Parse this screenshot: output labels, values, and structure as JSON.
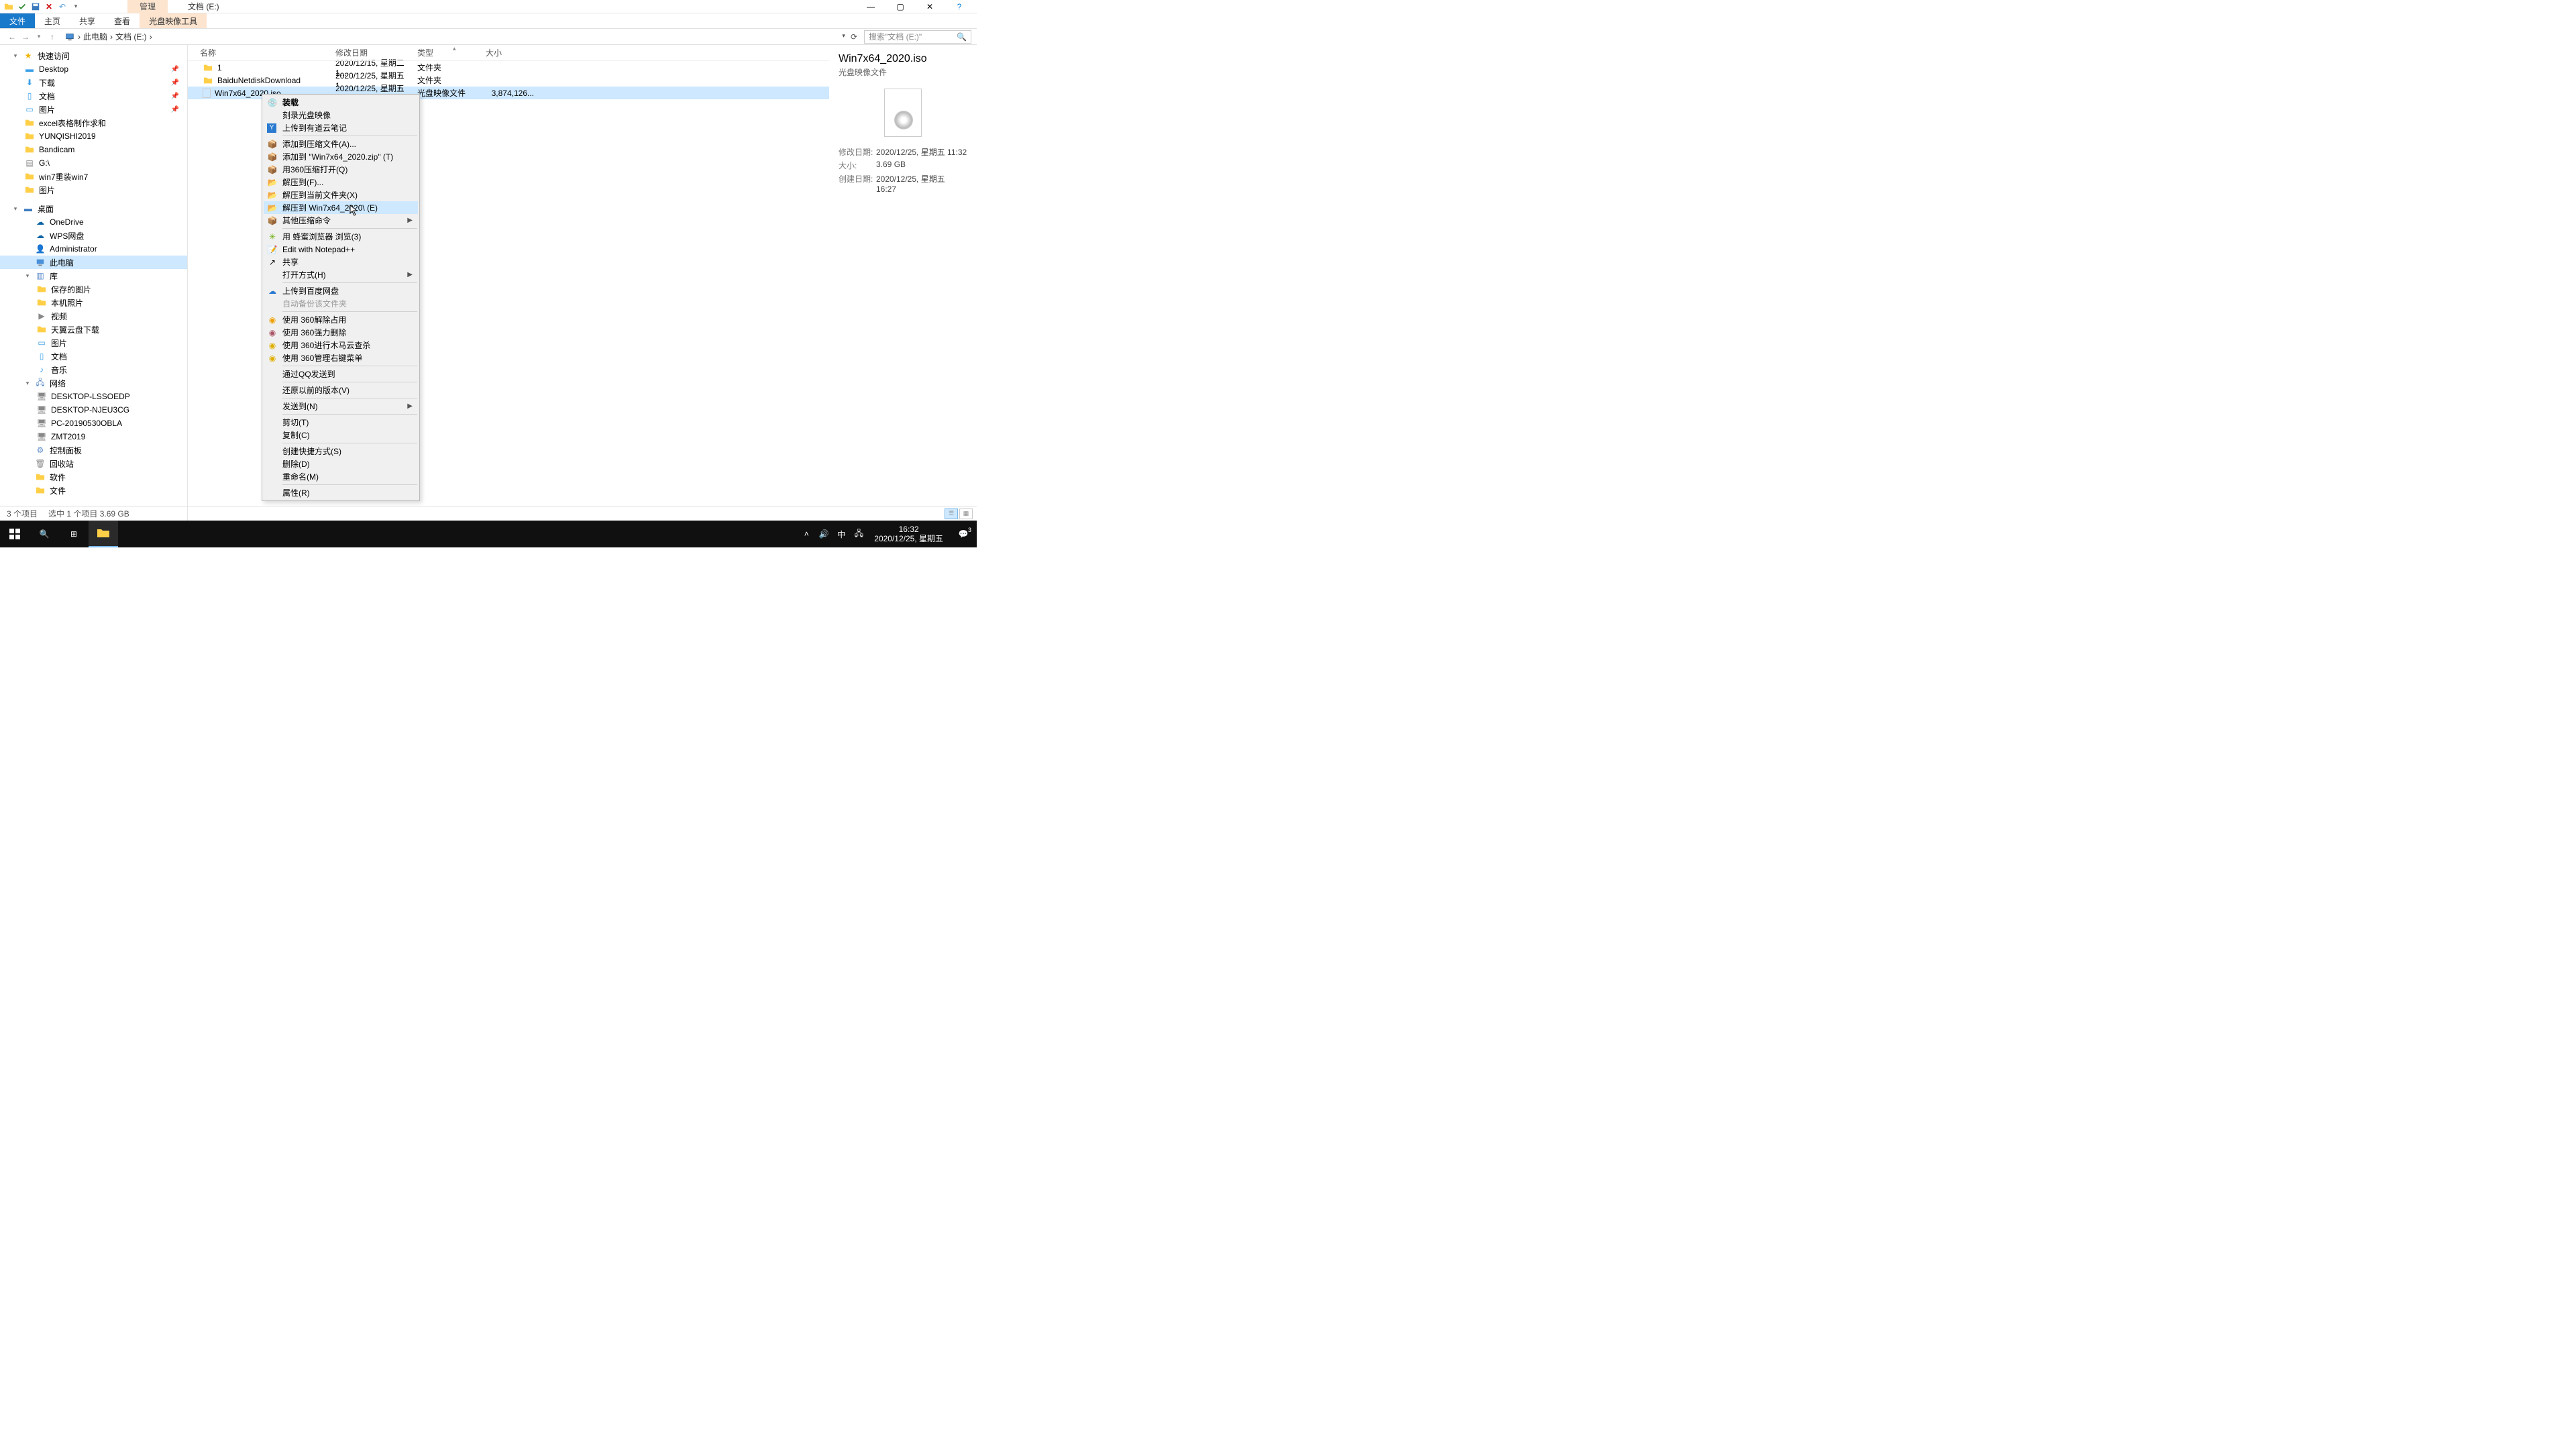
{
  "window": {
    "title": "文档 (E:)"
  },
  "ribbon": {
    "manage_tab": "管理",
    "file_tab": "文件",
    "home": "主页",
    "share": "共享",
    "view": "查看",
    "disc_tools": "光盘映像工具"
  },
  "win_btns": {
    "min": "—",
    "max": "▢",
    "close": "✕",
    "help": "?"
  },
  "address": {
    "root": "此电脑",
    "loc": "文档 (E:)",
    "search_ph": "搜索\"文档 (E:)\""
  },
  "tree": {
    "quick": "快速访问",
    "quick_items": [
      "Desktop",
      "下载",
      "文档",
      "图片",
      "excel表格制作求和",
      "YUNQISHI2019",
      "Bandicam",
      "G:\\",
      "win7重装win7",
      "图片"
    ],
    "desktop_root": "桌面",
    "desktop_items": [
      "OneDrive",
      "WPS网盘",
      "Administrator",
      "此电脑",
      "库"
    ],
    "lib_items": [
      "保存的图片",
      "本机照片",
      "视频",
      "天翼云盘下载",
      "图片",
      "文档",
      "音乐"
    ],
    "network": "网络",
    "net_items": [
      "DESKTOP-LSSOEDP",
      "DESKTOP-NJEU3CG",
      "PC-20190530OBLA",
      "ZMT2019"
    ],
    "other": [
      "控制面板",
      "回收站",
      "软件",
      "文件"
    ]
  },
  "columns": {
    "name": "名称",
    "date": "修改日期",
    "type": "类型",
    "size": "大小"
  },
  "rows": [
    {
      "name": "1",
      "date": "2020/12/15, 星期二 1...",
      "type": "文件夹",
      "size": ""
    },
    {
      "name": "BaiduNetdiskDownload",
      "date": "2020/12/25, 星期五 1...",
      "type": "文件夹",
      "size": ""
    },
    {
      "name": "Win7x64_2020.iso",
      "date": "2020/12/25, 星期五 1...",
      "type": "光盘映像文件",
      "size": "3,874,126..."
    }
  ],
  "menu": {
    "mount": "装载",
    "burn": "刻录光盘映像",
    "youdao": "上传到有道云笔记",
    "add_archive": "添加到压缩文件(A)...",
    "add_zip": "添加到 \"Win7x64_2020.zip\" (T)",
    "open_360": "用360压缩打开(Q)",
    "extract_to": "解压到(F)...",
    "extract_here": "解压到当前文件夹(X)",
    "extract_named": "解压到 Win7x64_2020\\ (E)",
    "other_compress": "其他压缩命令",
    "browse_bee": "用 蜂蜜浏览器 浏览(3)",
    "notepad": "Edit with Notepad++",
    "share": "共享",
    "open_with": "打开方式(H)",
    "upload_baidu": "上传到百度网盘",
    "auto_backup": "自动备份该文件夹",
    "u360_unlock": "使用 360解除占用",
    "u360_delete": "使用 360强力删除",
    "u360_trojan": "使用 360进行木马云查杀",
    "u360_manage": "使用 360管理右键菜单",
    "qq_send": "通过QQ发送到",
    "restore": "还原以前的版本(V)",
    "send_to": "发送到(N)",
    "cut": "剪切(T)",
    "copy": "复制(C)",
    "shortcut": "创建快捷方式(S)",
    "delete": "删除(D)",
    "rename": "重命名(M)",
    "props": "属性(R)"
  },
  "details": {
    "title": "Win7x64_2020.iso",
    "subtitle": "光盘映像文件",
    "mdate_l": "修改日期:",
    "mdate_v": "2020/12/25, 星期五 11:32",
    "size_l": "大小:",
    "size_v": "3.69 GB",
    "cdate_l": "创建日期:",
    "cdate_v": "2020/12/25, 星期五 16:27"
  },
  "status": {
    "count": "3 个项目",
    "selected": "选中 1 个项目  3.69 GB"
  },
  "taskbar": {
    "time": "16:32",
    "date": "2020/12/25, 星期五",
    "ime": "中",
    "notif": "3"
  }
}
